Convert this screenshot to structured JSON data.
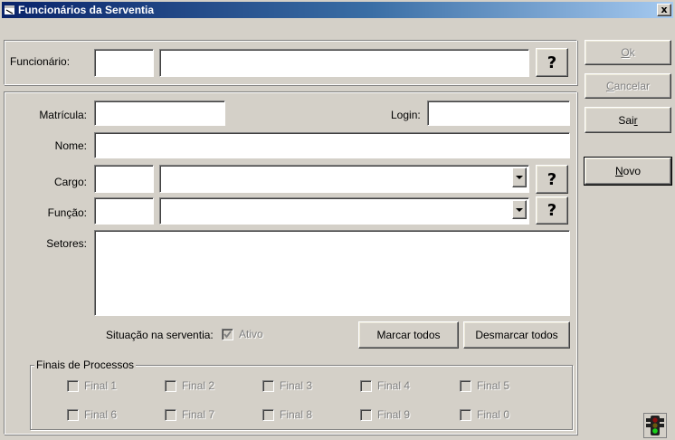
{
  "window": {
    "title": "Funcionários da Serventia",
    "close": "x"
  },
  "funcionario": {
    "label": "Funcionário:",
    "help": "?"
  },
  "matricula": {
    "label": "Matrícula:"
  },
  "login": {
    "label": "Login:"
  },
  "nome": {
    "label": "Nome:"
  },
  "cargo": {
    "label": "Cargo:",
    "help": "?"
  },
  "funcao": {
    "label": "Função:",
    "help": "?"
  },
  "setores": {
    "label": "Setores:"
  },
  "situacao": {
    "label": "Situação na serventia:",
    "checkbox_label": "Ativo",
    "checked": true
  },
  "buttons": {
    "marcar_todos": "Marcar todos",
    "desmarcar_todos": "Desmarcar todos",
    "ok": {
      "mnemonic": "O",
      "rest": "k"
    },
    "cancelar": {
      "mnemonic": "C",
      "rest": "ancelar"
    },
    "sair": {
      "pre": "Sai",
      "mnemonic": "r"
    },
    "novo": {
      "mnemonic": "N",
      "rest": "ovo"
    }
  },
  "finais": {
    "legend": "Finais de Processos",
    "row1": [
      "Final 1",
      "Final 2",
      "Final 3",
      "Final 4",
      "Final 5"
    ],
    "row2": [
      "Final 6",
      "Final 7",
      "Final 8",
      "Final 9",
      "Final 0"
    ]
  },
  "icons": {
    "window": "app-window-icon",
    "close": "close-icon",
    "status": "traffic-light-icon"
  },
  "colors": {
    "titlebar_start": "#0a246a",
    "titlebar_end": "#a6caf0",
    "face": "#d4d0c8"
  }
}
